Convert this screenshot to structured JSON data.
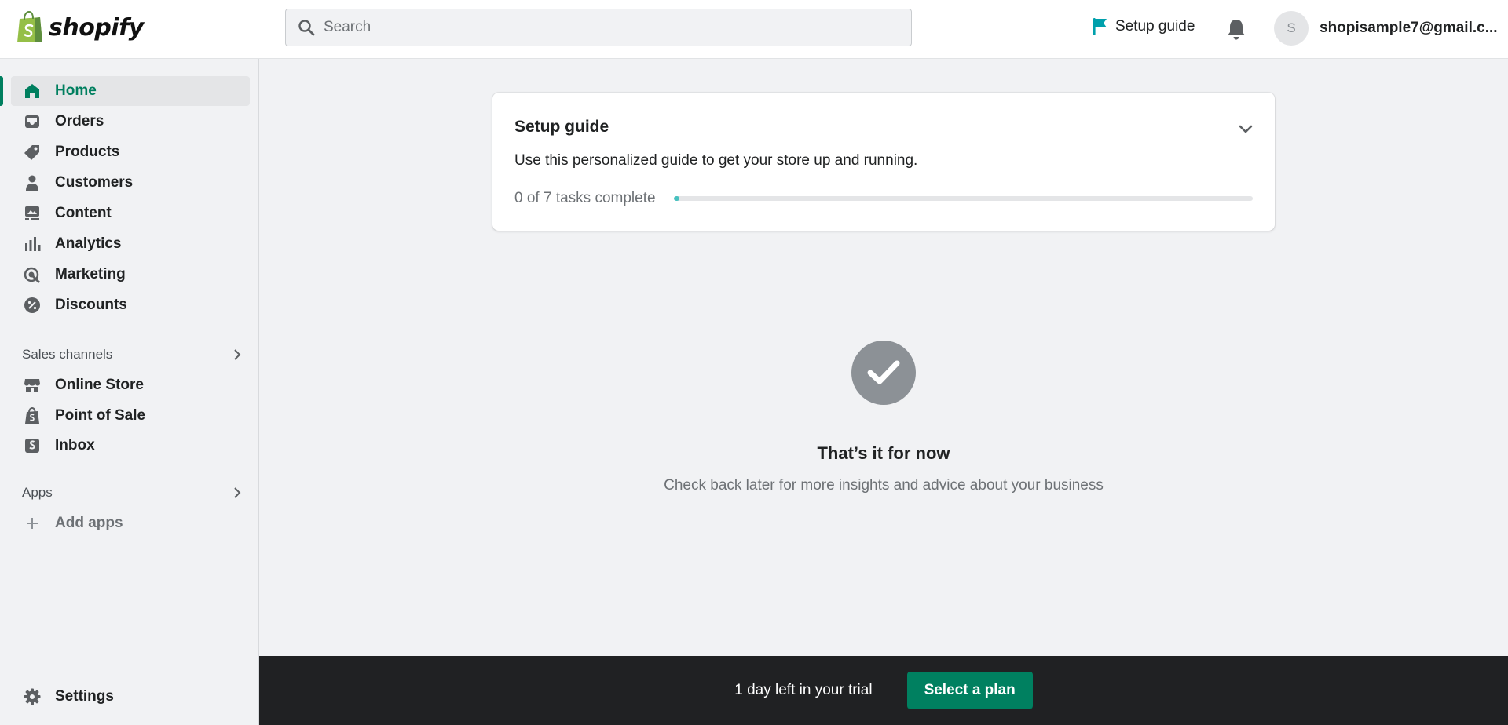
{
  "app": {
    "logo_text": "shopify"
  },
  "search": {
    "placeholder": "Search"
  },
  "header": {
    "setup_guide_label": "Setup guide",
    "avatar_initial": "S",
    "account_email": "shopisample7@gmail.c..."
  },
  "sidebar": {
    "items": [
      {
        "label": "Home",
        "icon": "home-icon",
        "active": true
      },
      {
        "label": "Orders",
        "icon": "inbox-tray-icon"
      },
      {
        "label": "Products",
        "icon": "tag-icon"
      },
      {
        "label": "Customers",
        "icon": "person-icon"
      },
      {
        "label": "Content",
        "icon": "image-gallery-icon"
      },
      {
        "label": "Analytics",
        "icon": "bar-chart-icon"
      },
      {
        "label": "Marketing",
        "icon": "target-icon"
      },
      {
        "label": "Discounts",
        "icon": "discount-badge-icon"
      }
    ],
    "sales_channels_title": "Sales channels",
    "sales_channels": [
      {
        "label": "Online Store",
        "icon": "storefront-icon"
      },
      {
        "label": "Point of Sale",
        "icon": "pos-bag-icon"
      },
      {
        "label": "Inbox",
        "icon": "chat-inbox-icon"
      }
    ],
    "apps_title": "Apps",
    "add_apps_label": "Add apps",
    "settings_label": "Settings"
  },
  "setup_card": {
    "title": "Setup guide",
    "description": "Use this personalized guide to get your store up and running.",
    "progress_text": "0 of 7 tasks complete",
    "tasks_completed": 0,
    "tasks_total": 7,
    "progress_fraction_shown": 0.01
  },
  "empty_state": {
    "title": "That’s it for now",
    "subtitle": "Check back later for more insights and advice about your business"
  },
  "trial": {
    "text": "1 day left in your trial",
    "button_label": "Select a plan"
  },
  "colors": {
    "brand_green": "#008060",
    "active_nav": "#007f5f",
    "progress_teal": "#47c1bf",
    "trial_bar": "#202123",
    "flag_teal": "#00a0ac"
  }
}
